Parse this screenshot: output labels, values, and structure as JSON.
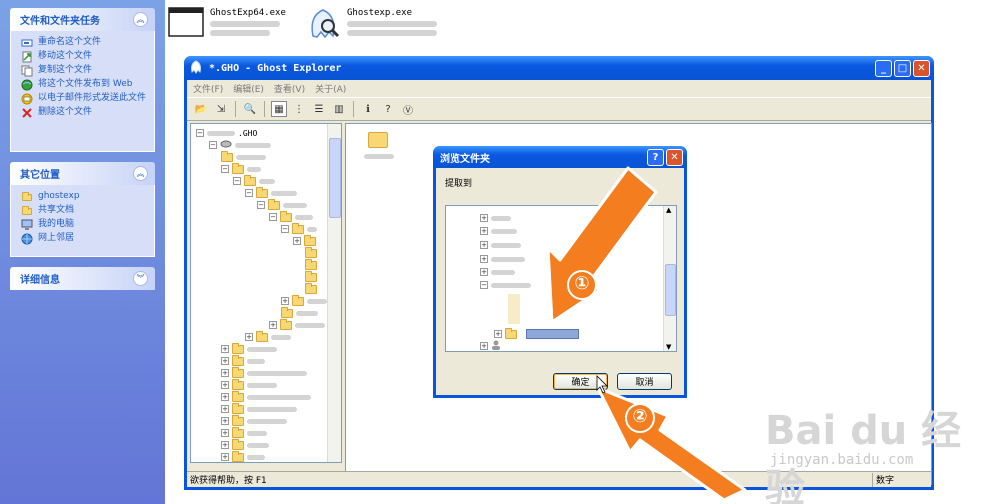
{
  "taskpane": {
    "panels": [
      {
        "title": "文件和文件夹任务",
        "items": [
          {
            "label": "重命名这个文件",
            "icon": "rename-icon"
          },
          {
            "label": "移动这个文件",
            "icon": "move-icon"
          },
          {
            "label": "复制这个文件",
            "icon": "copy-icon"
          },
          {
            "label": "将这个文件发布到 Web",
            "icon": "publish-web-icon"
          },
          {
            "label": "以电子邮件形式发送此文件",
            "icon": "email-icon"
          },
          {
            "label": "删除这个文件",
            "icon": "delete-icon"
          }
        ]
      },
      {
        "title": "其它位置",
        "items": [
          {
            "label": "ghostexp",
            "icon": "folder-icon"
          },
          {
            "label": "共享文档",
            "icon": "folder-icon"
          },
          {
            "label": "我的电脑",
            "icon": "computer-icon"
          },
          {
            "label": "网上邻居",
            "icon": "network-icon"
          }
        ]
      },
      {
        "title": "详细信息"
      }
    ]
  },
  "files": [
    {
      "name": "GhostExp64.exe"
    },
    {
      "name": "Ghostexp.exe"
    }
  ],
  "explorer": {
    "title": "*.GHO - Ghost Explorer",
    "menu": [
      "文件(F)",
      "编辑(E)",
      "查看(V)",
      "关于(A)"
    ],
    "tree_root": ".GHO",
    "status": "欲获得帮助，按 F1",
    "status_right": "数字"
  },
  "dialog": {
    "title": "浏览文件夹",
    "label": "提取到",
    "ok": "确定",
    "cancel": "取消"
  },
  "annotations": {
    "step1": "①",
    "step2": "②"
  },
  "watermark": {
    "brand": "Bai du 经验",
    "url": "jingyan.baidu.com"
  },
  "colors": {
    "accent_orange": "#f47d20",
    "xp_blue": "#0a55e0"
  }
}
